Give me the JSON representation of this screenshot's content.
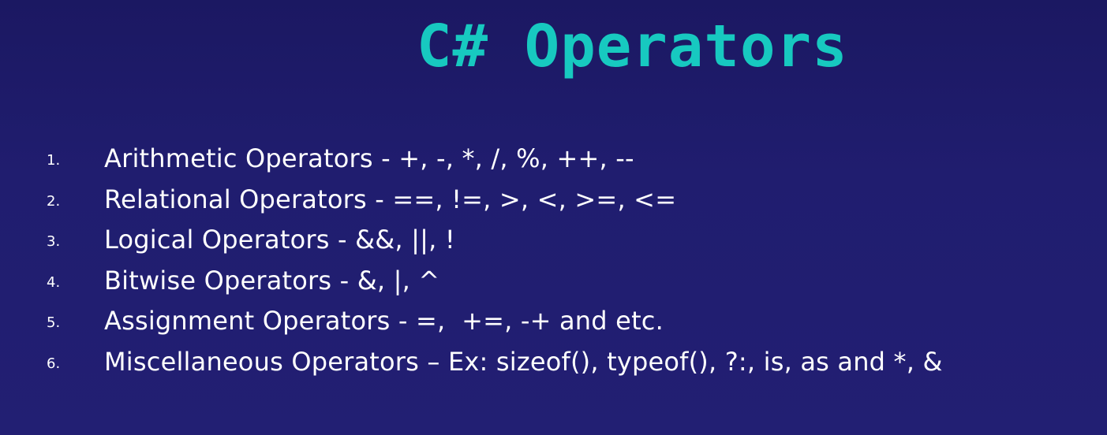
{
  "slide": {
    "title": "C# Operators",
    "items": [
      {
        "number": "1.",
        "text": "Arithmetic Operators - +, -, *, /, %, ++, --"
      },
      {
        "number": "2.",
        "text": "Relational Operators - ==, !=, >, <, >=, <="
      },
      {
        "number": "3.",
        "text": "Logical Operators - &&, ||, !"
      },
      {
        "number": "4.",
        "text": "Bitwise Operators - &, |, ^"
      },
      {
        "number": "5.",
        "text": "Assignment Operators - =,  +=, -+ and etc."
      },
      {
        "number": "6.",
        "text": "Miscellaneous Operators – Ex: sizeof(), typeof(), ?:, is, as and *, &"
      }
    ]
  },
  "colors": {
    "background": "#1e1b6b",
    "title": "#17c9c0",
    "text": "#ffffff"
  }
}
